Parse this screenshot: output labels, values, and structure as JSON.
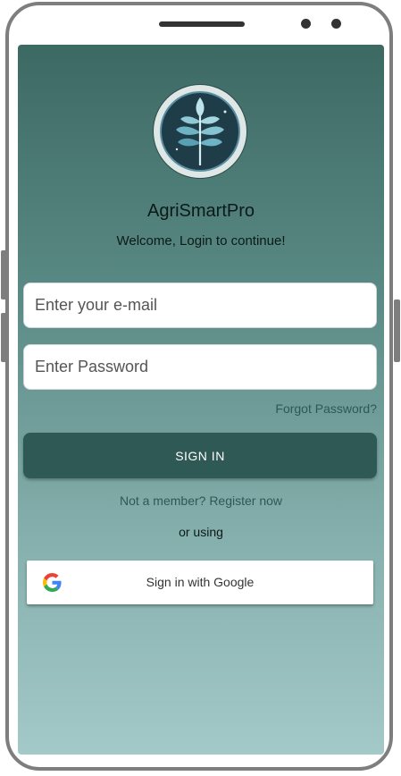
{
  "app": {
    "title": "AgriSmartPro",
    "welcome": "Welcome, Login to continue!"
  },
  "form": {
    "email_placeholder": "Enter your e-mail",
    "password_placeholder": "Enter Password",
    "forgot_label": "Forgot Password?",
    "signin_label": "SIGN IN",
    "register_label": "Not a member? Register now",
    "or_label": "or using",
    "google_label": "Sign in with Google"
  },
  "icons": {
    "logo": "leaf-logo-icon",
    "google": "google-icon"
  },
  "colors": {
    "primary": "#2f5955",
    "gradient_top": "#3d6963",
    "gradient_bottom": "#a3c9c8",
    "link": "#2f5855"
  }
}
